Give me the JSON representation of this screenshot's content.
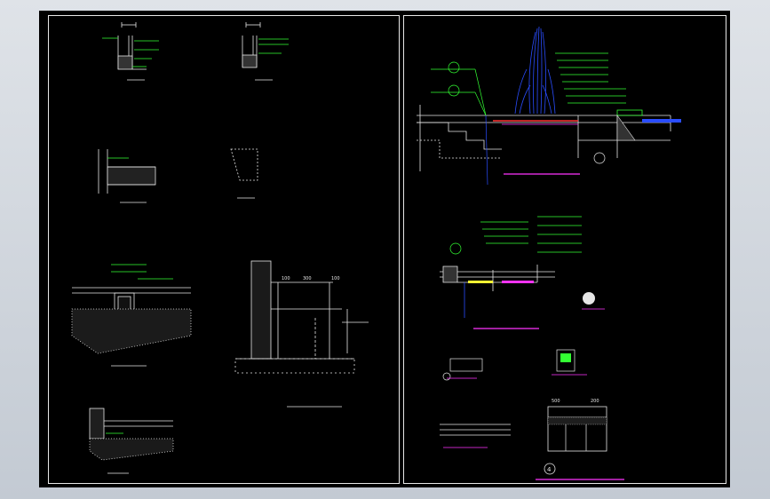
{
  "window": {
    "title": ""
  },
  "left_sheet": {
    "captions": {
      "detail_1": "",
      "detail_2": "",
      "detail_3": "",
      "detail_4": "",
      "detail_5": "",
      "detail_6_title": "",
      "detail_6_sub": "",
      "detail_7": ""
    },
    "dims": {
      "d100a": "100",
      "d300": "300",
      "d100b": "100"
    },
    "labels": [
      "",
      "",
      ""
    ]
  },
  "right_sheet": {
    "captions": {
      "section_main": "",
      "section_2": "",
      "small_1": "",
      "small_2": "",
      "small_3": "",
      "title_num": "4",
      "title": ""
    },
    "elevation": "",
    "dims": {
      "d500": "500",
      "d200": "200"
    }
  },
  "colors": {
    "line_white": "#e6e6e6",
    "line_green": "#33ff33",
    "line_magenta": "#ff33ff",
    "line_blue": "#2a4dff",
    "line_yellow": "#ffff33",
    "line_red": "#ff3333",
    "line_cyan": "#33ffff"
  }
}
